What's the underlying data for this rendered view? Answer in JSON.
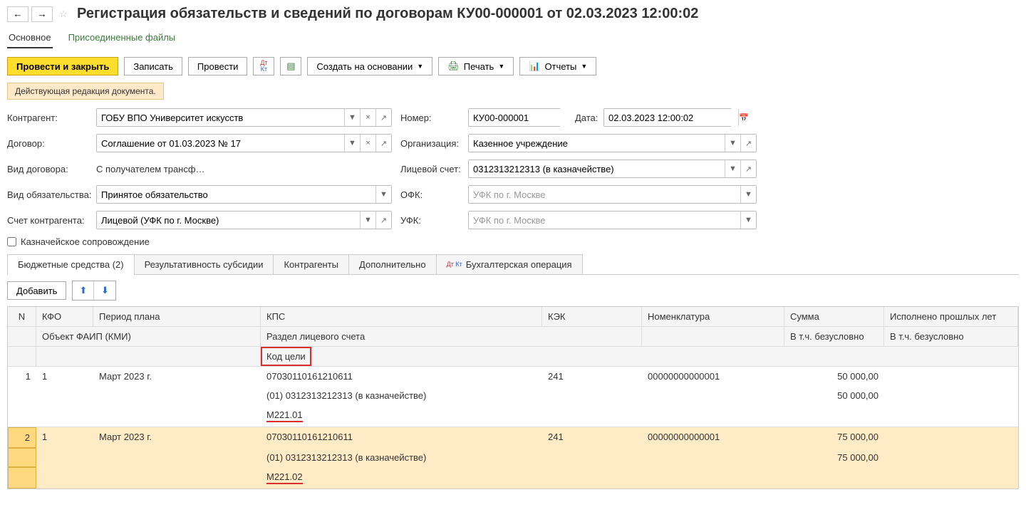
{
  "header": {
    "title": "Регистрация обязательств и сведений по договорам КУ00-000001 от 02.03.2023 12:00:02"
  },
  "navtabs": {
    "main": "Основное",
    "files": "Присоединенные файлы"
  },
  "toolbar": {
    "post_close": "Провести и закрыть",
    "save": "Записать",
    "post": "Провести",
    "create_based": "Создать на основании",
    "print": "Печать",
    "reports": "Отчеты"
  },
  "status": "Действующая редакция документа.",
  "form": {
    "contragent_label": "Контрагент:",
    "contragent_value": "ГОБУ ВПО Университет искусств",
    "contract_label": "Договор:",
    "contract_value": "Соглашение от 01.03.2023 № 17",
    "contract_type_label": "Вид договора:",
    "contract_type_value": "С получателем трансф…",
    "obligation_type_label": "Вид обязательства:",
    "obligation_type_value": "Принятое обязательство",
    "account_label": "Счет контрагента:",
    "account_value": "Лицевой (УФК по г. Москве)",
    "number_label": "Номер:",
    "number_value": "КУ00-000001",
    "date_label": "Дата:",
    "date_value": "02.03.2023 12:00:02",
    "org_label": "Организация:",
    "org_value": "Казенное учреждение",
    "ls_label": "Лицевой счет:",
    "ls_value": "0312313212313 (в казначействе)",
    "ofk_label": "ОФК:",
    "ofk_value": "УФК по г. Москве",
    "ufk_label": "УФК:",
    "ufk_value": "УФК по г. Москве",
    "treasury_checkbox": "Казначейское сопровождение"
  },
  "subtabs": {
    "budget": "Бюджетные средства (2)",
    "result": "Результативность субсидии",
    "contragents": "Контрагенты",
    "additional": "Дополнительно",
    "accounting": "Бухгалтерская операция"
  },
  "subtoolbar": {
    "add": "Добавить"
  },
  "table": {
    "headers": {
      "n": "N",
      "kfo": "КФО",
      "period": "Период плана",
      "kps": "КПС",
      "kek": "КЭК",
      "nom": "Номенклатура",
      "sum": "Сумма",
      "executed": "Исполнено прошлых лет",
      "faip": "Объект ФАИП (КМИ)",
      "razdel": "Раздел лицевого счета",
      "kod_celi": "Код цели",
      "vtch": "В т.ч. безусловно"
    },
    "rows": [
      {
        "n": "1",
        "kfo": "1",
        "period": "Март 2023 г.",
        "kps": "07030110161210611",
        "kek": "241",
        "nom": "00000000000001",
        "sum": "50 000,00",
        "razdel": "(01) 0312313212313 (в казначействе)",
        "vtch_sum": "50 000,00",
        "kod_celi": "М221.01"
      },
      {
        "n": "2",
        "kfo": "1",
        "period": "Март 2023 г.",
        "kps": "07030110161210611",
        "kek": "241",
        "nom": "00000000000001",
        "sum": "75 000,00",
        "razdel": "(01) 0312313212313 (в казначействе)",
        "vtch_sum": "75 000,00",
        "kod_celi": "М221.02"
      }
    ]
  }
}
